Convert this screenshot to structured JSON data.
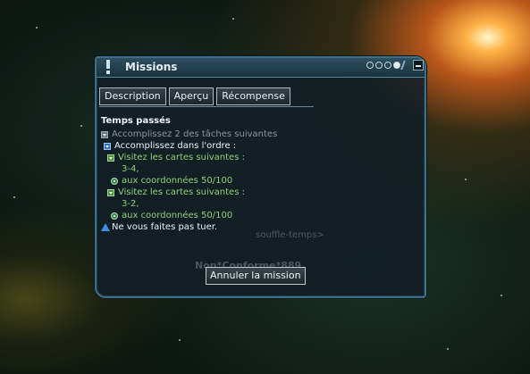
{
  "window": {
    "title": "Missions",
    "title_icon": "exclamation-icon",
    "controls": [
      "dot-toggle",
      "dot-toggle",
      "dot-toggle",
      "dot-toggle-filled",
      "pin-icon",
      "minimize-icon"
    ]
  },
  "tabs": [
    {
      "label": "Description"
    },
    {
      "label": "Aperçu"
    },
    {
      "label": "Récompense"
    }
  ],
  "objective": {
    "heading": "Temps passés",
    "items": [
      {
        "text": "Accomplissez 2 des tâches suivantes",
        "icon": "collapse-box-icon",
        "style": "gray",
        "indent": 0
      },
      {
        "text": "Accomplissez dans l'ordre :",
        "icon": "collapse-box-icon",
        "style": "white",
        "indent": 1
      },
      {
        "text": "Visitez les cartes suivantes :",
        "icon": "collapse-box-icon",
        "style": "green",
        "indent": 2
      },
      {
        "text": "3-4,",
        "icon": "",
        "style": "green",
        "indent": 3
      },
      {
        "text": "aux coordonnées 50/100",
        "icon": "coordinate-icon",
        "style": "green",
        "indent": 2
      },
      {
        "text": "Visitez les cartes suivantes :",
        "icon": "collapse-box-icon",
        "style": "green",
        "indent": 2
      },
      {
        "text": "3-2,",
        "icon": "",
        "style": "green",
        "indent": 3
      },
      {
        "text": "aux coordonnées 50/100",
        "icon": "coordinate-icon",
        "style": "green",
        "indent": 2
      },
      {
        "text": "Ne vous faites pas tuer.",
        "icon": "warning-icon",
        "style": "white",
        "indent": 0
      }
    ]
  },
  "background_text": {
    "player_tag": "souffle-temps>",
    "player_name": "Non*Conforme*889"
  },
  "buttons": {
    "cancel": "Annuler la mission"
  },
  "colors": {
    "window_bg": "#121e26",
    "window_border": "#3f6f86",
    "objective_green": "#8fd07a",
    "objective_gray": "#8a969c"
  }
}
